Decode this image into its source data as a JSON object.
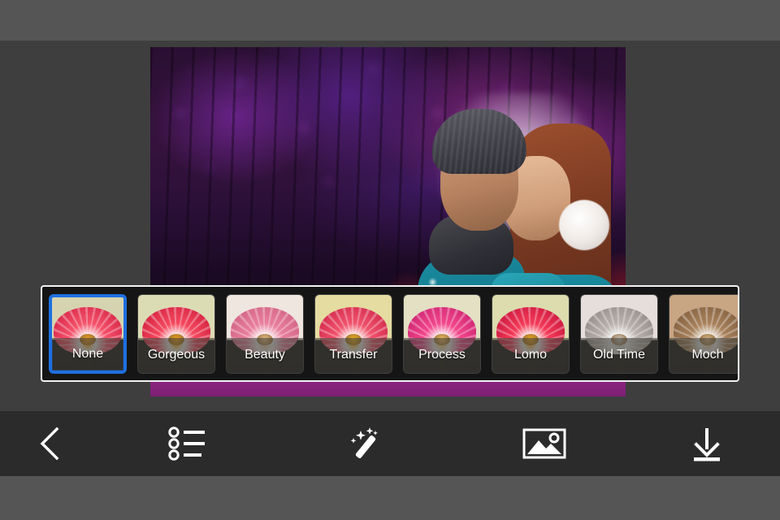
{
  "app": {
    "screen_name": "photo-filter-editor",
    "background_color": "#555555",
    "canvas_color": "#3e3e3e",
    "toolbar_color": "#2b2b2b"
  },
  "photo": {
    "name": "edited-photo",
    "description": "Couple embracing in winter clothing over a night scene of illuminated Christmas trees",
    "footer_band_color": "#9b2a8e"
  },
  "filter_strip": {
    "border_color": "#f2f2f2",
    "background_color": "#151515",
    "selected_index": 0,
    "selection_color": "#1f6fe0",
    "filters": [
      {
        "label": "None",
        "selected": true,
        "img_top": "#d6d4b0",
        "petal_a": "#f5536b",
        "petal_b": "#d21f43",
        "center": "#f0a020"
      },
      {
        "label": "Gorgeous",
        "selected": false,
        "img_top": "#dcdcb4",
        "petal_a": "#f4495f",
        "petal_b": "#cf1b3c",
        "center": "#f2a418"
      },
      {
        "label": "Beauty",
        "selected": false,
        "img_top": "#efe6e0",
        "petal_a": "#e87f9e",
        "petal_b": "#cf5f81",
        "center": "#e6c08a"
      },
      {
        "label": "Transfer",
        "selected": false,
        "img_top": "#e4dca0",
        "petal_a": "#f0536c",
        "petal_b": "#cd2347",
        "center": "#f3b41c"
      },
      {
        "label": "Process",
        "selected": false,
        "img_top": "#e3e0c4",
        "petal_a": "#f2478c",
        "petal_b": "#c81f6e",
        "center": "#f0c060"
      },
      {
        "label": "Lomo",
        "selected": false,
        "img_top": "#dcdcae",
        "petal_a": "#f43a58",
        "petal_b": "#c4123a",
        "center": "#f0a81c"
      },
      {
        "label": "Old Time",
        "selected": false,
        "img_top": "#e6dedb",
        "petal_a": "#b9b2ae",
        "petal_b": "#8d8783",
        "center": "#cfc8c3"
      },
      {
        "label": "Moch",
        "selected": false,
        "img_top": "#c8a583",
        "petal_a": "#a8825c",
        "petal_b": "#7c5a3a",
        "center": "#d8b88c"
      }
    ]
  },
  "toolbar": {
    "items": [
      {
        "name": "back-button",
        "icon": "chevron-left-icon"
      },
      {
        "name": "list-button",
        "icon": "list-icon"
      },
      {
        "name": "effects-button",
        "icon": "magic-wand-icon"
      },
      {
        "name": "gallery-button",
        "icon": "image-icon"
      },
      {
        "name": "save-button",
        "icon": "download-icon"
      }
    ]
  }
}
